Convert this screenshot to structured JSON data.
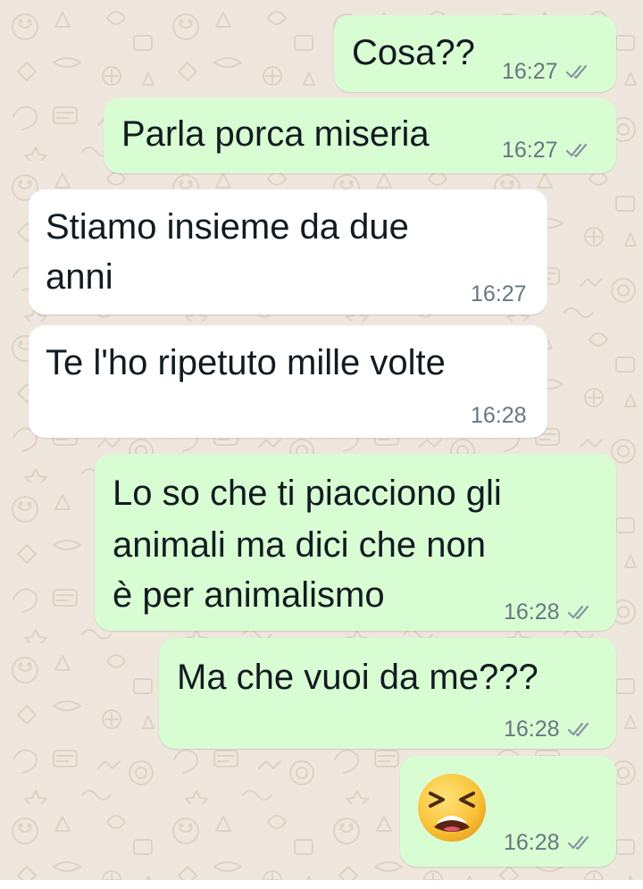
{
  "chat": {
    "wallpaper_icon": "doodle-pattern",
    "colors": {
      "outgoing_bubble": "#d9fdd3",
      "incoming_bubble": "#ffffff",
      "text": "#111b21",
      "meta": "#667781",
      "read_ticks": "#8696a0",
      "background": "#efe7dd"
    },
    "messages": [
      {
        "direction": "outgoing",
        "text": "Cosa??",
        "time": "16:27",
        "status": "read"
      },
      {
        "direction": "outgoing",
        "text": "Parla porca miseria",
        "time": "16:27",
        "status": "read"
      },
      {
        "direction": "incoming",
        "lines": [
          "Stiamo insieme da due",
          "anni"
        ],
        "time": "16:27"
      },
      {
        "direction": "incoming",
        "text": "Te l'ho ripetuto mille volte",
        "time": "16:28"
      },
      {
        "direction": "outgoing",
        "lines": [
          "Lo so che ti piacciono gli",
          "animali ma dici che non",
          "è per animalismo"
        ],
        "time": "16:28",
        "status": "read"
      },
      {
        "direction": "outgoing",
        "text": "Ma che vuoi da me???",
        "time": "16:28",
        "status": "read"
      },
      {
        "direction": "outgoing",
        "emoji": "tired-face-emoji",
        "time": "16:28",
        "status": "read"
      }
    ]
  }
}
